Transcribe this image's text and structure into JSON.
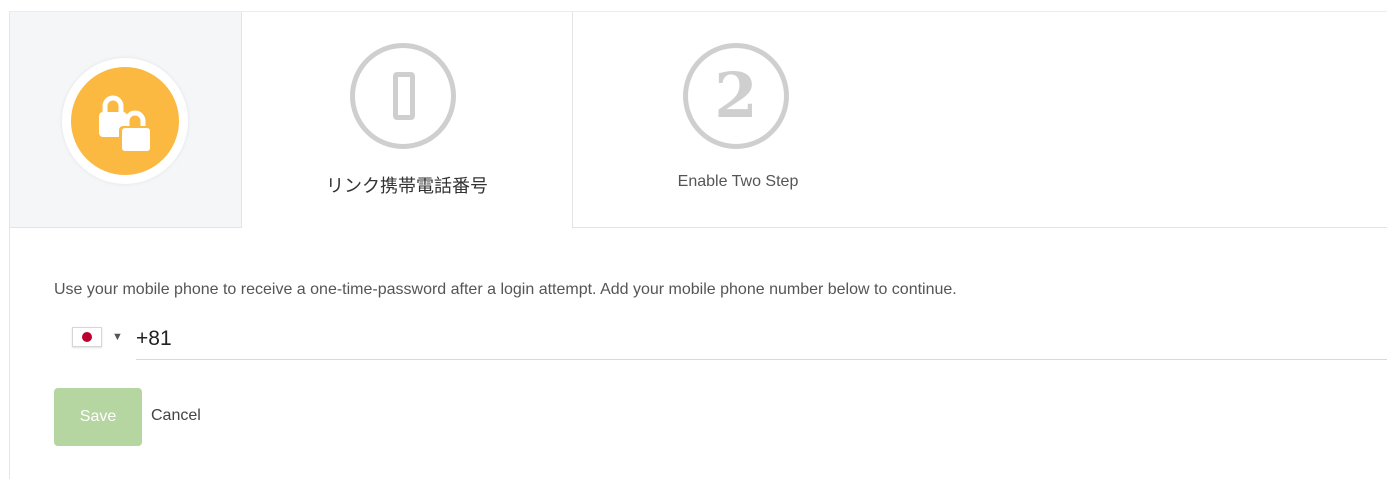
{
  "steps": [
    {
      "label": "リンク携帯電話番号",
      "icon": "mobile-phone-icon",
      "active": true
    },
    {
      "label": "Enable Two Step",
      "icon": "number-two-icon",
      "number": "2",
      "active": false
    }
  ],
  "lock_icon": "locks-icon",
  "colors": {
    "lock_badge": "#fcb941",
    "step_circle": "#cfcfcf",
    "save_button": "#b5d6a0",
    "flag_red": "#bc002d"
  },
  "form": {
    "description": "Use your mobile phone to receive a one-time-password after a login attempt. Add your mobile phone number below to continue.",
    "country_flag_icon": "japan-flag-icon",
    "phone_value": "+81",
    "save_label": "Save",
    "cancel_label": "Cancel"
  }
}
